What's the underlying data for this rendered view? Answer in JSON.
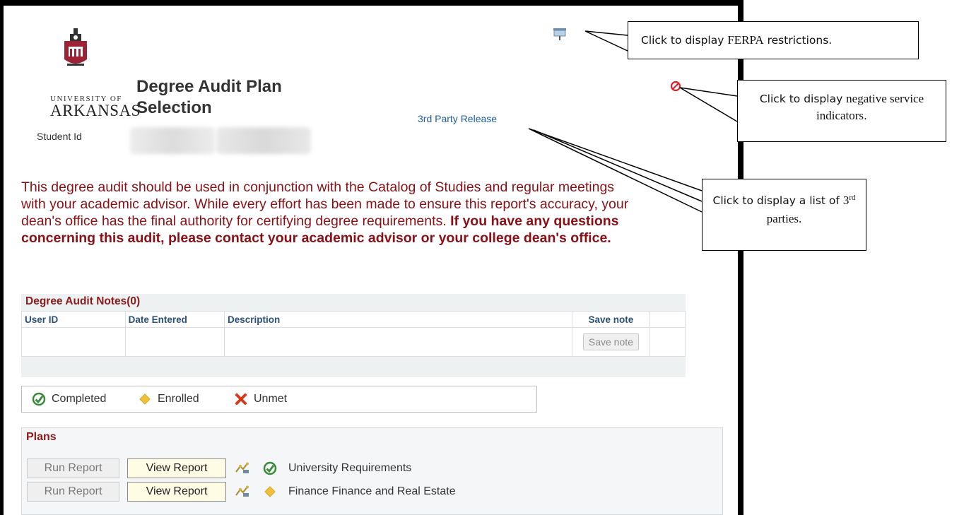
{
  "header": {
    "logo_line1": "UNIVERSITY OF",
    "logo_line2": "ARKANSAS",
    "page_title": "Degree Audit Plan Selection",
    "student_id_label": "Student Id",
    "third_party_link": "3rd Party Release"
  },
  "disclaimer": {
    "normal": "This degree audit should be used in conjunction with the Catalog of Studies and regular meetings with your academic advisor. While every effort has been made to ensure this report's accuracy, your dean's office has the final authority for certifying degree requirements. ",
    "bold": "If you have any questions concerning this audit, please contact your academic advisor or your college dean's office."
  },
  "notes": {
    "title": "Degree Audit Notes(0)",
    "columns": [
      "User ID",
      "Date Entered",
      "Description",
      "Save note"
    ],
    "save_button": "Save note"
  },
  "legend": {
    "completed": "Completed",
    "enrolled": "Enrolled",
    "unmet": "Unmet"
  },
  "plans": {
    "title": "Plans",
    "run_label": "Run Report",
    "view_label": "View Report",
    "rows": [
      {
        "status": "completed",
        "label": "University Requirements"
      },
      {
        "status": "enrolled",
        "label": "Finance Finance and Real Estate"
      }
    ]
  },
  "callouts": {
    "ferpa_pre": "Click to display ",
    "ferpa_strong": "FERPA",
    "ferpa_post": " restrictions.",
    "nsi_pre": "Click to display ",
    "nsi_strong": "negative service indicators",
    "nsi_post": ".",
    "third_pre": "Click to display a list of ",
    "third_num": "3",
    "third_sup": "rd",
    "third_post": " parties."
  },
  "colors": {
    "disclaimer": "#8b1015",
    "link": "#1f5d9e",
    "section_title": "#8b1a1a",
    "column_header": "#2a4f7a",
    "completed": "#3b8a3a",
    "enrolled": "#f0c23b",
    "unmet": "#d23a1e"
  }
}
